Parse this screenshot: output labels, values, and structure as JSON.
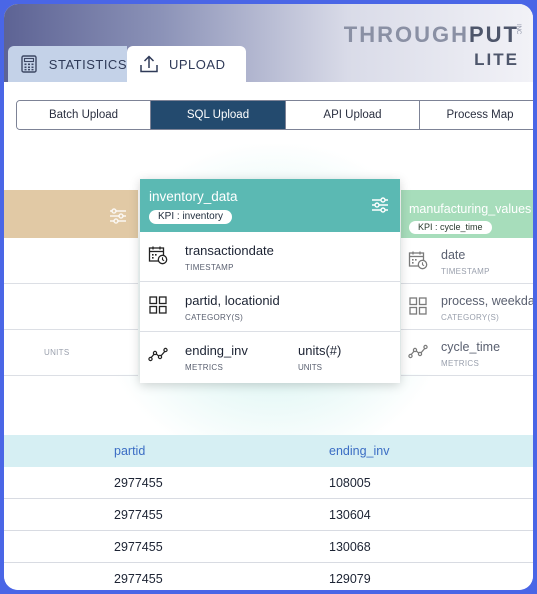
{
  "brand": {
    "name_light": "THROUGH",
    "name_dark": "PUT",
    "inc": "INC",
    "edition": "LITE"
  },
  "tabs": [
    {
      "label": "STATISTICS",
      "icon": "calculator-icon"
    },
    {
      "label": "UPLOAD",
      "icon": "upload-icon"
    }
  ],
  "subtabs": [
    "Batch Upload",
    "SQL Upload",
    "API Upload",
    "Process Map"
  ],
  "active_subtab": "SQL Upload",
  "left_card": {
    "rows": [
      {
        "type": ""
      },
      {
        "type": ""
      },
      {
        "type": "UNITS"
      }
    ]
  },
  "main_card": {
    "title": "inventory_data",
    "kpi": "KPI : inventory",
    "rows": [
      {
        "icon": "calendar-clock-icon",
        "name": "transactiondate",
        "type": "TIMESTAMP"
      },
      {
        "icon": "grid-icon",
        "name": "partid, locationid",
        "type": "CATEGORY(S)"
      },
      {
        "icon": "line-chart-icon",
        "name": "ending_inv",
        "type": "METRICS",
        "name2": "units(#)",
        "type2": "UNITS"
      }
    ]
  },
  "right_card": {
    "title": "manufacturing_values",
    "kpi": "KPI : cycle_time",
    "rows": [
      {
        "icon": "calendar-clock-icon",
        "name": "date",
        "type": "TIMESTAMP"
      },
      {
        "icon": "grid-icon",
        "name": "process, weekda",
        "type": "CATEGORY(S)"
      },
      {
        "icon": "line-chart-icon",
        "name": "cycle_time",
        "type": "METRICS"
      }
    ]
  },
  "table": {
    "headers": [
      "partid",
      "ending_inv"
    ],
    "rows": [
      [
        "2977455",
        "108005"
      ],
      [
        "2977455",
        "130604"
      ],
      [
        "2977455",
        "130068"
      ],
      [
        "2977455",
        "129079"
      ]
    ]
  }
}
